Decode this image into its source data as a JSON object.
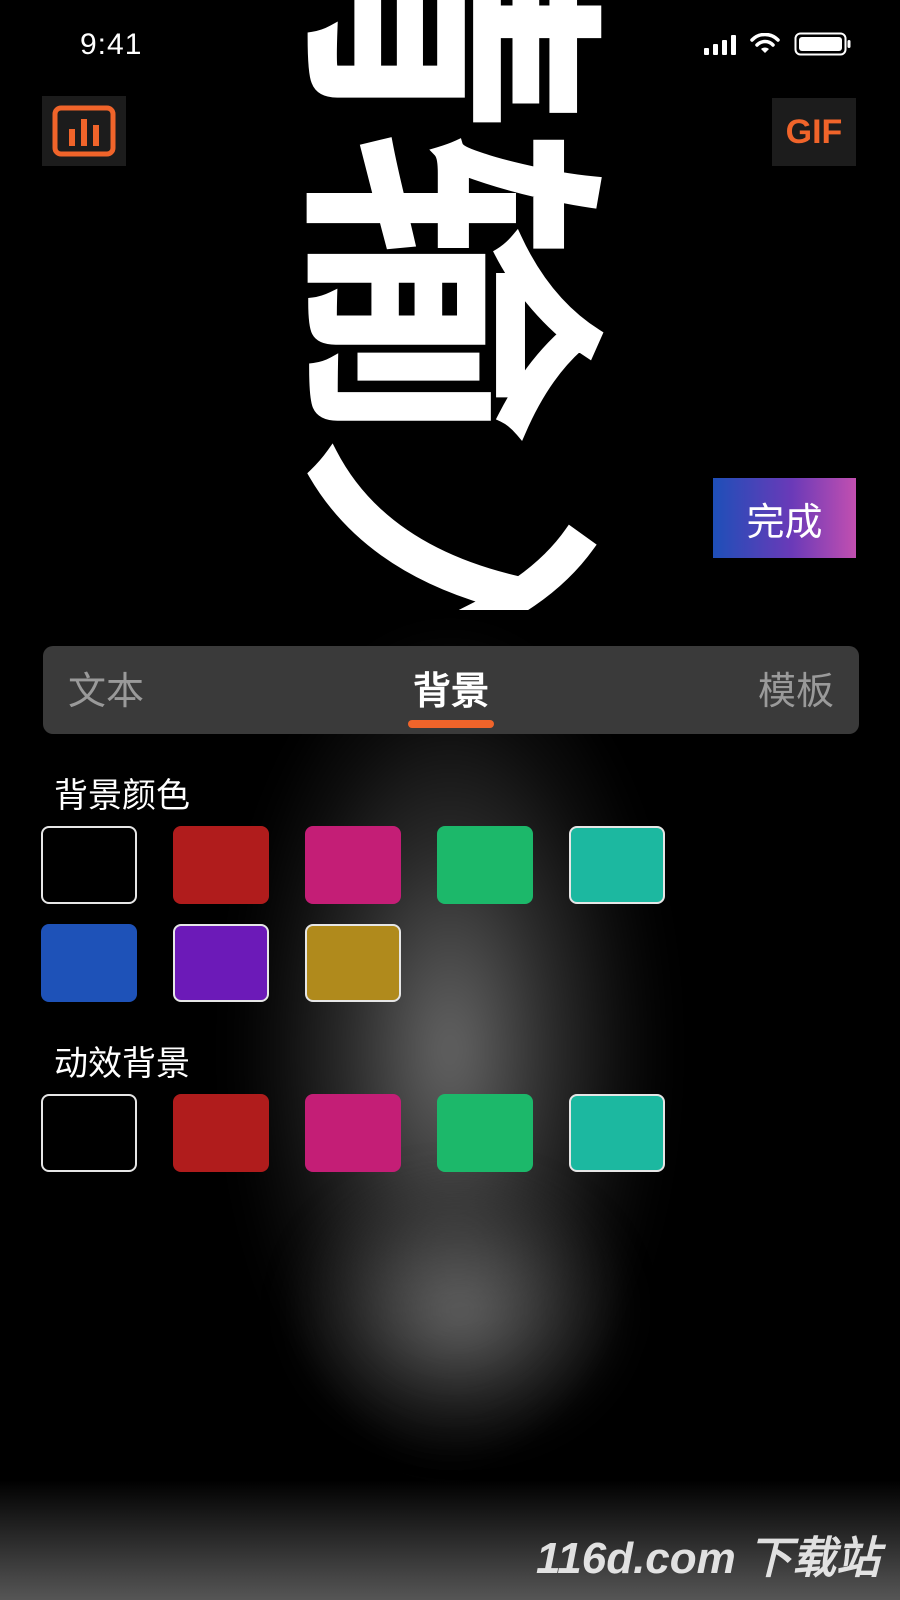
{
  "status_bar": {
    "time": "9:41"
  },
  "marquee": {
    "text": "请输入"
  },
  "toolbar": {
    "chart_icon": "bar-chart-icon",
    "gif_label": "GIF",
    "done_label": "完成",
    "accent_color": "#f0642a"
  },
  "tabs": [
    {
      "label": "文本",
      "active": false
    },
    {
      "label": "背景",
      "active": true
    },
    {
      "label": "模板",
      "active": false
    }
  ],
  "background_colors": {
    "title": "背景颜色",
    "swatches": [
      "#000000",
      "#b01c1c",
      "#c41e76",
      "#1cb86a",
      "#1cb8a0",
      "#1e52b8",
      "#6c1ab8",
      "#b08a1c"
    ]
  },
  "animated_backgrounds": {
    "title": "动效背景",
    "swatches": [
      "#000000",
      "#b01c1c",
      "#c41e76",
      "#1cb86a",
      "#1cb8a0"
    ]
  },
  "watermark": {
    "text": "116d.com 下载站"
  }
}
